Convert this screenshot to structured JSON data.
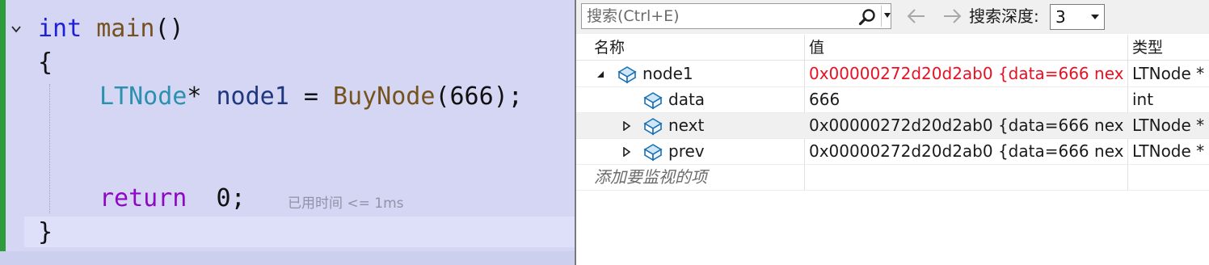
{
  "editor": {
    "lines": {
      "l1": {
        "kw": "int",
        "fn": "main",
        "punct": "()"
      },
      "l2": {
        "brace": "{"
      },
      "l3": {
        "type": "LTNode",
        "star": "*",
        "var": "node1",
        "eq": "=",
        "fn": "BuyNode",
        "paren_open": "(",
        "arg": "666",
        "paren_close": ");"
      },
      "l5": {
        "kw": "return",
        "num": "0",
        "semi": ";"
      },
      "l6": {
        "brace": "}"
      }
    },
    "elapsed_hint": "已用时间 <= 1ms"
  },
  "watch": {
    "search": {
      "placeholder": "搜索(Ctrl+E)",
      "value": ""
    },
    "depth": {
      "label": "搜索深度:",
      "value": "3"
    },
    "columns": {
      "name": "名称",
      "value": "值",
      "type": "类型"
    },
    "rows": [
      {
        "name": "node1",
        "value": "0x00000272d20d2ab0 {data=666 nex...",
        "type": "LTNode *",
        "expanded": true,
        "changed": true
      },
      {
        "name": "data",
        "value": "666",
        "type": "int",
        "expanded": null,
        "changed": false
      },
      {
        "name": "next",
        "value": "0x00000272d20d2ab0 {data=666 nex...",
        "type": "LTNode *",
        "expanded": false,
        "changed": false,
        "selected": true
      },
      {
        "name": "prev",
        "value": "0x00000272d20d2ab0 {data=666 nex...",
        "type": "LTNode *",
        "expanded": false,
        "changed": false
      }
    ],
    "add_item_hint": "添加要监视的项"
  },
  "colors": {
    "editor_bg": "#d4d6f4",
    "keyword": "#1f1fd6",
    "function": "#74531f",
    "type": "#2b91af",
    "variable": "#1f377f",
    "control": "#8f08c4",
    "changed_value": "#e81123",
    "breakpoint_margin": "#2e9c3c"
  },
  "icons": {
    "fold": "collapse-chevron-icon",
    "search": "search-icon",
    "back": "arrow-left-icon",
    "forward": "arrow-right-icon",
    "object": "struct-field-icon",
    "expanded": "expanded-triangle-icon",
    "collapsed": "collapsed-triangle-icon"
  }
}
